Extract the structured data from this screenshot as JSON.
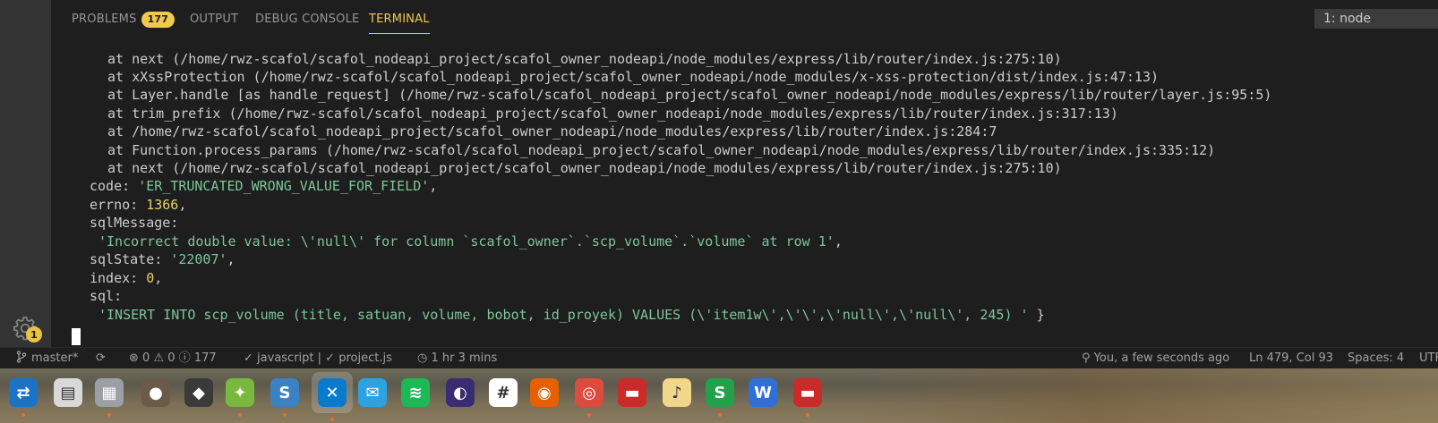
{
  "panel": {
    "tabs": [
      {
        "label": "PROBLEMS",
        "badge": "177"
      },
      {
        "label": "OUTPUT"
      },
      {
        "label": "DEBUG CONSOLE"
      },
      {
        "label": "TERMINAL"
      }
    ],
    "terminal_select": "1: node"
  },
  "terminal": {
    "stack": [
      "at next (/home/rwz-scafol/scafol_nodeapi_project/scafol_owner_nodeapi/node_modules/express/lib/router/index.js:275:10)",
      "at xXssProtection (/home/rwz-scafol/scafol_nodeapi_project/scafol_owner_nodeapi/node_modules/x-xss-protection/dist/index.js:47:13)",
      "at Layer.handle [as handle_request] (/home/rwz-scafol/scafol_nodeapi_project/scafol_owner_nodeapi/node_modules/express/lib/router/layer.js:95:5)",
      "at trim_prefix (/home/rwz-scafol/scafol_nodeapi_project/scafol_owner_nodeapi/node_modules/express/lib/router/index.js:317:13)",
      "at /home/rwz-scafol/scafol_nodeapi_project/scafol_owner_nodeapi/node_modules/express/lib/router/index.js:284:7",
      "at Function.process_params (/home/rwz-scafol/scafol_nodeapi_project/scafol_owner_nodeapi/node_modules/express/lib/router/index.js:335:12)",
      "at next (/home/rwz-scafol/scafol_nodeapi_project/scafol_owner_nodeapi/node_modules/express/lib/router/index.js:275:10)"
    ],
    "code_key": "code: ",
    "code_val": "'ER_TRUNCATED_WRONG_VALUE_FOR_FIELD'",
    "errno_key": "errno: ",
    "errno_val": "1366",
    "sqlmsg_key": "sqlMessage:",
    "sqlmsg_val": "'Incorrect double value: \\'null\\' for column `scafol_owner`.`scp_volume`.`volume` at row 1'",
    "sqlstate_key": "sqlState: ",
    "sqlstate_val": "'22007'",
    "index_key": "index: ",
    "index_val": "0",
    "sql_key": "sql:",
    "sql_val": "'INSERT INTO scp_volume (title, satuan, volume, bobot, id_proyek) VALUES (\\'item1w\\',\\'\\',\\'null\\',\\'null\\', 245) '",
    "comma": ",",
    "closing": " }"
  },
  "activity": {
    "settings_badge": "1"
  },
  "statusbar": {
    "branch": "master*",
    "errors": "0",
    "warnings": "0",
    "infos": "177",
    "language": "javascript |",
    "file": "project.js",
    "time": "1 hr 3 mins",
    "blame": "You, a few seconds ago",
    "position": "Ln 479, Col 93",
    "spaces": "Spaces: 4",
    "encoding": "UTF"
  },
  "dock": {
    "apps": [
      {
        "icon": "teamviewer-icon",
        "color": "#1a73c7"
      },
      {
        "icon": "document-viewer-icon",
        "color": "#d9d9d9"
      },
      {
        "icon": "archive-manager-icon",
        "color": "#9aa0a6"
      },
      {
        "icon": "gimp-icon",
        "color": "#6b5a4a"
      },
      {
        "icon": "inkscape-icon",
        "color": "#3a3a3a"
      },
      {
        "icon": "android-studio-icon",
        "color": "#78b83c"
      },
      {
        "icon": "simplenote-icon",
        "color": "#3b82c4"
      },
      {
        "icon": "vscode-icon",
        "color": "#0a7acc"
      },
      {
        "icon": "mail-icon",
        "color": "#2ba3e0"
      },
      {
        "icon": "spotify-icon",
        "color": "#1db954"
      },
      {
        "icon": "eclipse-icon",
        "color": "#3a2c73"
      },
      {
        "icon": "slack-icon",
        "color": "#ffffff"
      },
      {
        "icon": "firefox-icon",
        "color": "#e66000"
      },
      {
        "icon": "chrome-icon",
        "color": "#dd4b3e"
      },
      {
        "icon": "presentation-icon",
        "color": "#cc2a2a"
      },
      {
        "icon": "notes-icon",
        "color": "#f2d68a"
      },
      {
        "icon": "spreadsheet-icon",
        "color": "#23a04a"
      },
      {
        "icon": "writer-icon",
        "color": "#2f6fd6"
      },
      {
        "icon": "pdf-icon",
        "color": "#cc2a2a"
      }
    ]
  }
}
